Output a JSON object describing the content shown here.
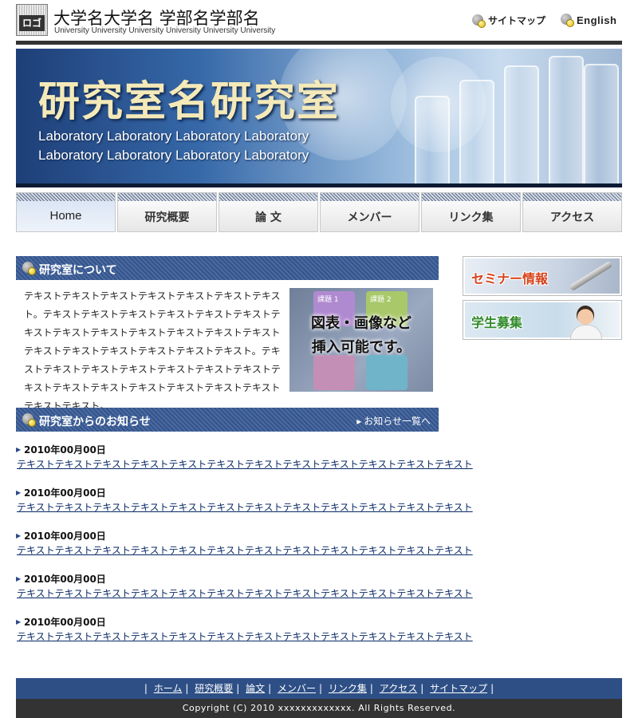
{
  "header": {
    "logo_label": "ロゴ",
    "university_name": "大学名大学名 学部名学部名",
    "university_sub": "University University University University University University",
    "sitemap_label": "サイトマップ",
    "english_label": "English"
  },
  "banner": {
    "title": "研究室名研究室",
    "subtitle_line1": "Laboratory Laboratory Laboratory Laboratory",
    "subtitle_line2": "Laboratory Laboratory Laboratory Laboratory"
  },
  "nav": {
    "items": [
      {
        "label": "Home",
        "active": true
      },
      {
        "label": "研究概要"
      },
      {
        "label": "論 文"
      },
      {
        "label": "メンバー"
      },
      {
        "label": "リンク集"
      },
      {
        "label": "アクセス"
      }
    ]
  },
  "about": {
    "heading": "研究室について",
    "text": "テキストテキストテキストテキストテキストテキストテキスト。テキストテキストテキストテキストテキストテキストテキストテキストテキストテキストテキストテキストテキストテキストテキストテキストテキストテキストテキスト。テキストテキストテキストテキストテキストテキストテキストテキストテキストテキストテキストテキストテキストテキストテキストテキスト。",
    "figure": {
      "box1": "課題 1",
      "box2": "課題 2",
      "caption_line1": "図表・画像など",
      "caption_line2": "挿入可能です。"
    }
  },
  "news": {
    "heading": "研究室からのお知らせ",
    "more_link": "お知らせ一覧へ",
    "items": [
      {
        "date": "2010年00月00日",
        "text": "テキストテキストテキストテキストテキストテキストテキストテキストテキストテキストテキストテキスト"
      },
      {
        "date": "2010年00月00日",
        "text": "テキストテキストテキストテキストテキストテキストテキストテキストテキストテキストテキストテキスト"
      },
      {
        "date": "2010年00月00日",
        "text": "テキストテキストテキストテキストテキストテキストテキストテキストテキストテキストテキストテキスト"
      },
      {
        "date": "2010年00月00日",
        "text": "テキストテキストテキストテキストテキストテキストテキストテキストテキストテキストテキストテキスト"
      },
      {
        "date": "2010年00月00日",
        "text": "テキストテキストテキストテキストテキストテキストテキストテキストテキストテキストテキストテキスト"
      }
    ]
  },
  "side": {
    "seminar_label": "セミナー情報",
    "recruit_label": "学生募集"
  },
  "footer": {
    "links": [
      "ホーム",
      "研究概要",
      "論文",
      "メンバー",
      "リンク集",
      "アクセス",
      "サイトマップ"
    ],
    "copyright": "Copyright (C) 2010 xxxxxxxxxxxxx. All Rights Reserved."
  },
  "colors": {
    "nav_blue": "#2e4f86",
    "section_header": "#3a5a92",
    "banner_title": "#f4e9b8",
    "seminar_label": "#d6421a",
    "recruit_label": "#2f8a2a"
  }
}
